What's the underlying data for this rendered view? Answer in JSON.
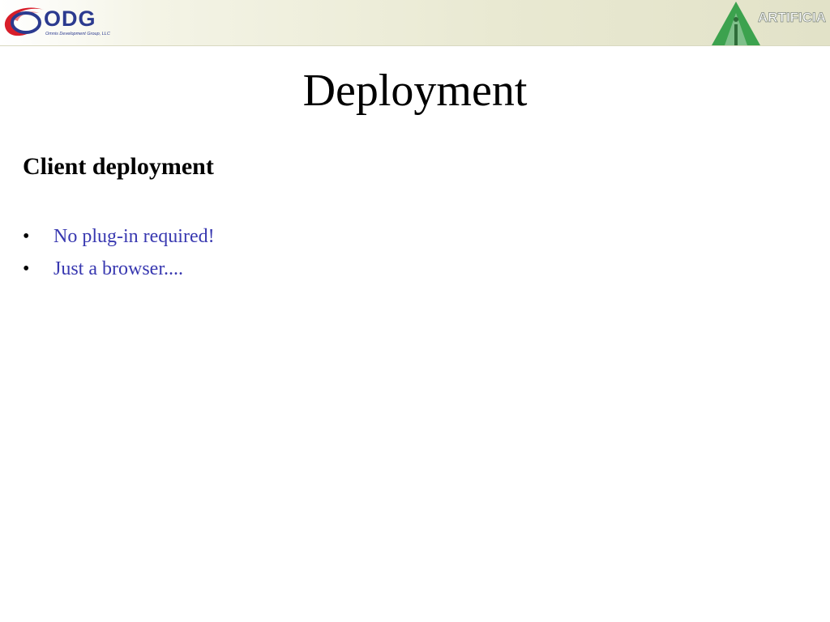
{
  "header": {
    "left_logo": {
      "wordmark": "ODG",
      "subtitle": "Omnis Development Group, LLC",
      "icon": "odg-swoosh-logo",
      "colors": {
        "swoosh": "#d81e2a",
        "text": "#2b3a8f"
      }
    },
    "right_logo": {
      "wordmark": "ARTIFICIA",
      "icon": "artificia-triangle-logo",
      "colors": {
        "triangle": "#3ca24e",
        "text_outline": "#808a80"
      }
    }
  },
  "slide": {
    "title": "Deployment",
    "section_heading": "Client deployment",
    "bullets": [
      {
        "text": "No plug-in required!"
      },
      {
        "text": "Just a browser...."
      }
    ],
    "bullet_symbol": "•",
    "colors": {
      "bullet_text": "#3838b0",
      "heading": "#000000"
    }
  }
}
